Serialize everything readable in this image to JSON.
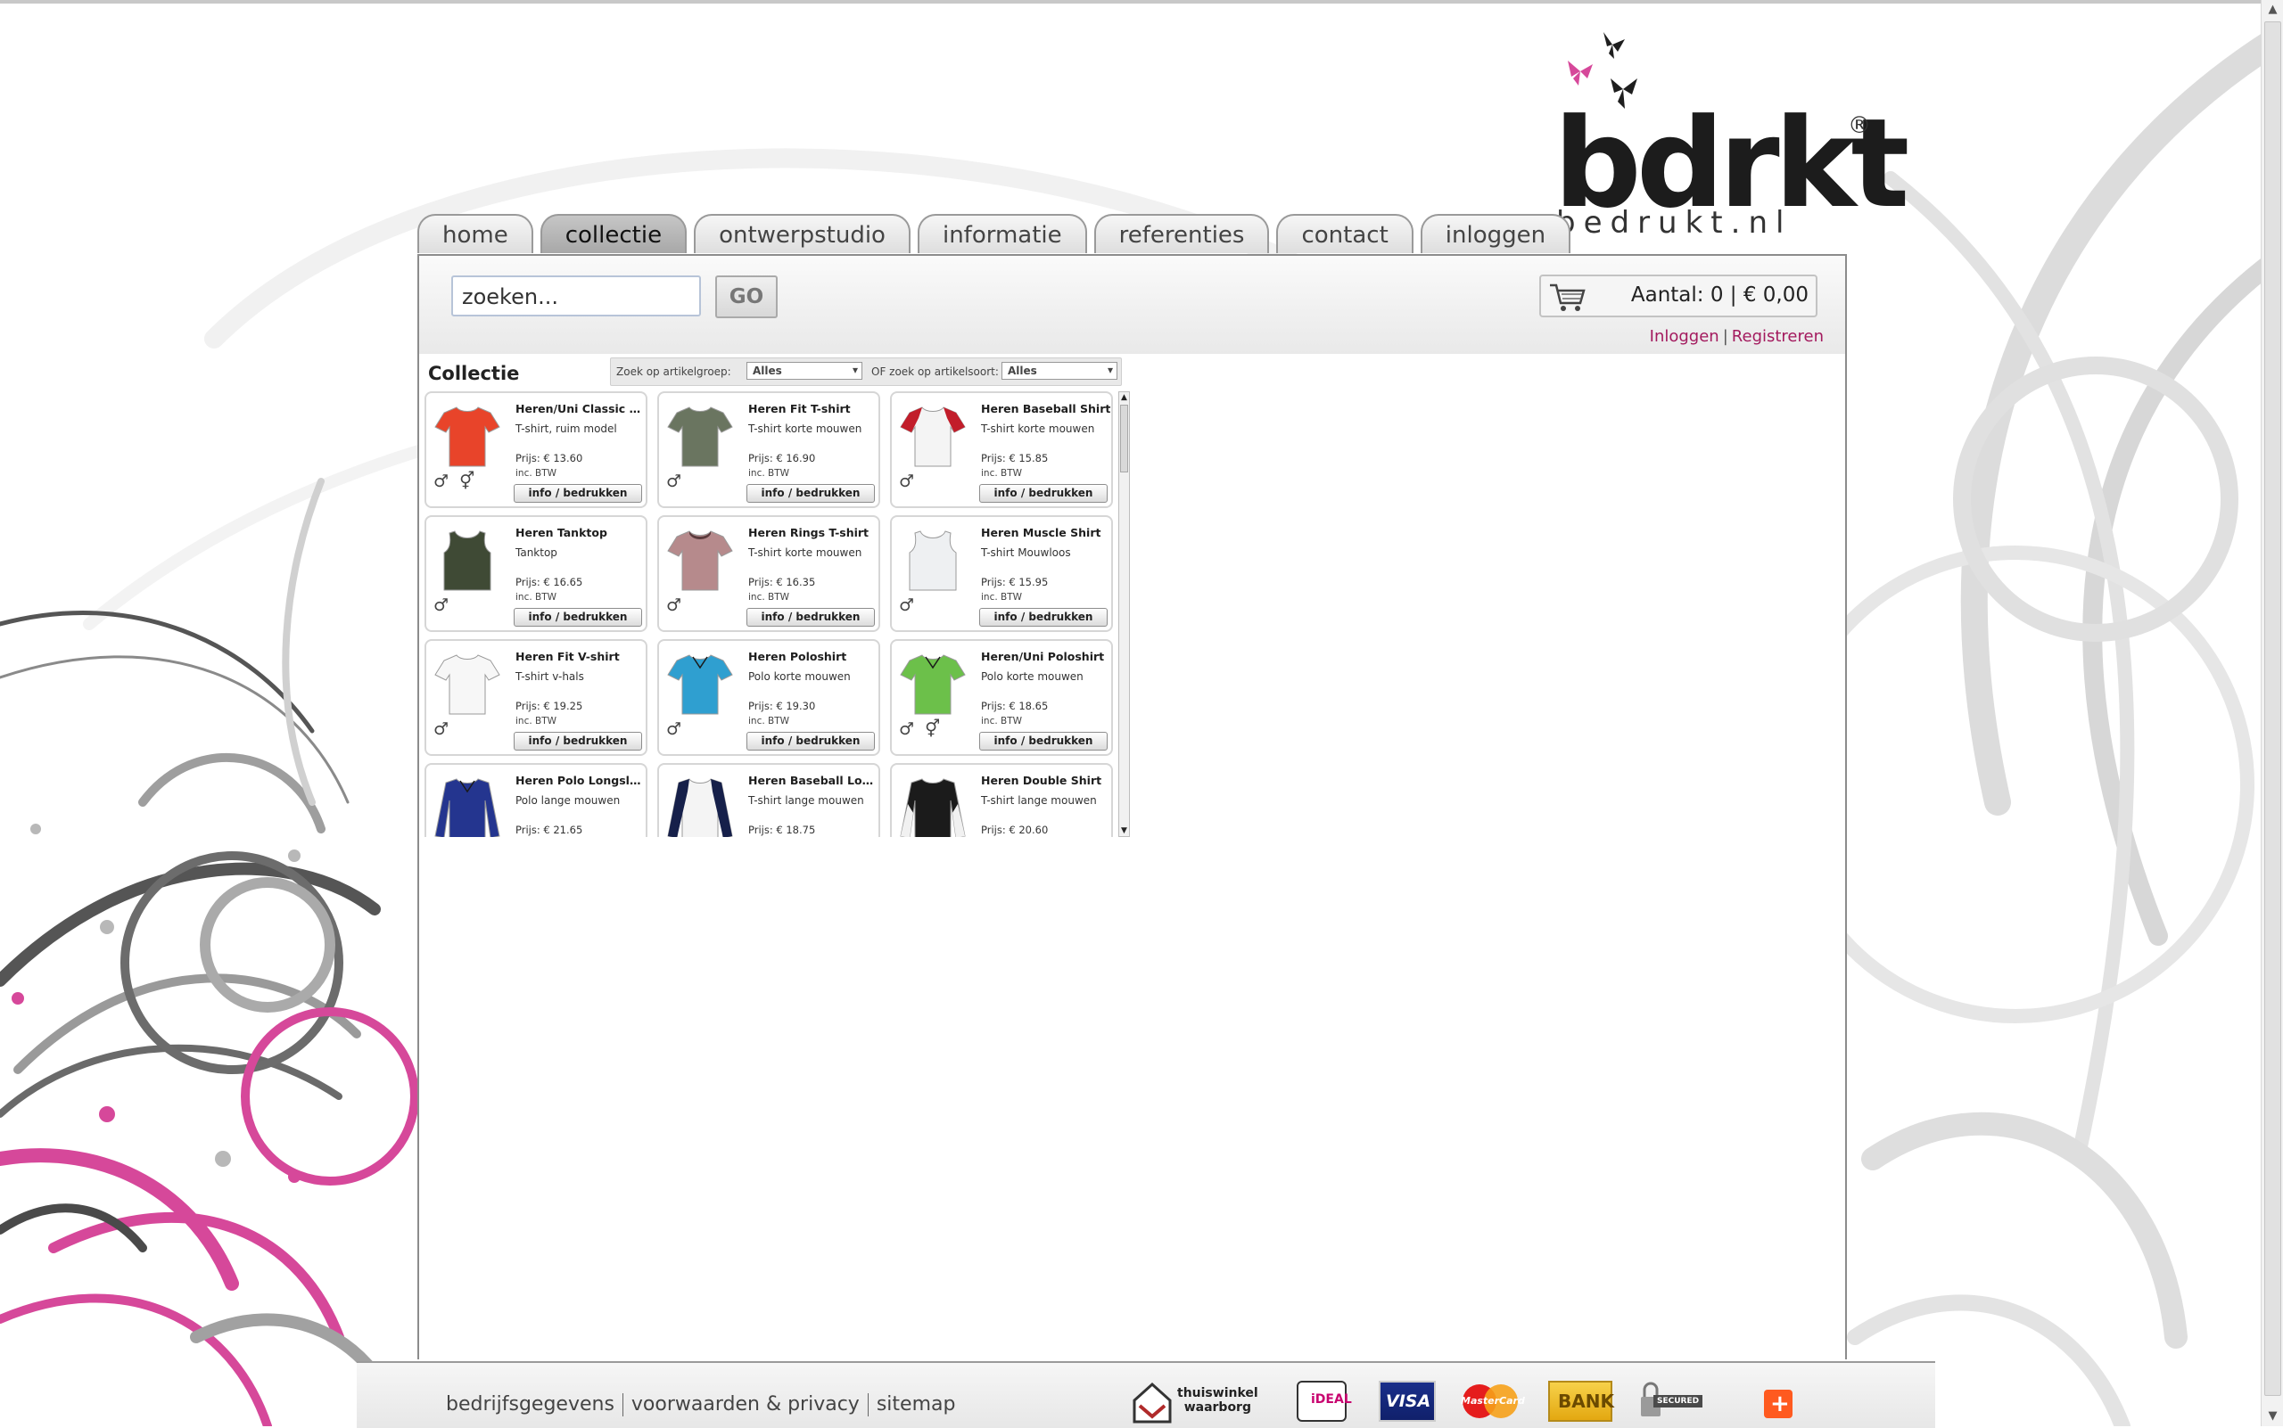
{
  "logo": {
    "brand": "bdrkt",
    "registered": "®",
    "subtitle": "bedrukt.nl"
  },
  "nav": {
    "home": "home",
    "collectie": "collectie",
    "ontwerpstudio": "ontwerpstudio",
    "informatie": "informatie",
    "referenties": "referenties",
    "contact": "contact",
    "inloggen": "inloggen",
    "active": "collectie"
  },
  "search": {
    "value": "zoeken...",
    "go_label": "GO"
  },
  "cart": {
    "summary": "Aantal: 0 | € 0,00"
  },
  "account": {
    "login": "Inloggen",
    "separator": "|",
    "register": "Registreren"
  },
  "collection": {
    "title": "Collectie",
    "filter_group_label": "Zoek op artikelgroep:",
    "filter_group_value": "Alles",
    "filter_type_label": "OF zoek op artikelsoort:",
    "filter_type_value": "Alles",
    "btw_label": "inc. BTW",
    "button_label": "info / bedrukken",
    "products": [
      {
        "name": "Heren/Uni Classic T-sh...",
        "desc": "T-shirt, ruim model",
        "price": "Prijs: € 13.60",
        "gender": "♂ ⚥",
        "color": "#e8442a",
        "shape": "tee"
      },
      {
        "name": "Heren Fit T-shirt",
        "desc": "T-shirt korte mouwen",
        "price": "Prijs: € 16.90",
        "gender": "♂",
        "color": "#6a7560",
        "shape": "tee"
      },
      {
        "name": "Heren Baseball Shirt",
        "desc": "T-shirt korte mouwen",
        "price": "Prijs: € 15.85",
        "gender": "♂",
        "color": "#f4f4f4",
        "accent": "#c21d2a",
        "shape": "raglan"
      },
      {
        "name": "Heren Tanktop",
        "desc": "Tanktop",
        "price": "Prijs: € 16.65",
        "gender": "♂",
        "color": "#3f4a35",
        "shape": "tank"
      },
      {
        "name": "Heren Rings T-shirt",
        "desc": "T-shirt korte mouwen",
        "price": "Prijs: € 16.35",
        "gender": "♂",
        "color": "#b68a8c",
        "accent": "#5a3a3c",
        "shape": "tee"
      },
      {
        "name": "Heren Muscle Shirt",
        "desc": "T-shirt Mouwloos",
        "price": "Prijs: € 15.95",
        "gender": "♂",
        "color": "#eef0f2",
        "shape": "tank"
      },
      {
        "name": "Heren Fit V-shirt",
        "desc": "T-shirt v-hals",
        "price": "Prijs: € 19.25",
        "gender": "♂",
        "color": "#f7f7f7",
        "shape": "tee"
      },
      {
        "name": "Heren Poloshirt",
        "desc": "Polo korte mouwen",
        "price": "Prijs: € 19.30",
        "gender": "♂",
        "color": "#2f9fd0",
        "shape": "polo"
      },
      {
        "name": "Heren/Uni Poloshirt",
        "desc": "Polo korte mouwen",
        "price": "Prijs: € 18.65",
        "gender": "♂ ⚥",
        "color": "#6cc04a",
        "shape": "polo"
      },
      {
        "name": "Heren Polo Longsleeve",
        "desc": "Polo lange mouwen",
        "price": "Prijs: € 21.65",
        "gender": "",
        "color": "#24358f",
        "shape": "long"
      },
      {
        "name": "Heren Baseball Longsl...",
        "desc": "T-shirt lange mouwen",
        "price": "Prijs: € 18.75",
        "gender": "",
        "color": "#f4f4f4",
        "accent": "#16204a",
        "shape": "longraglan"
      },
      {
        "name": "Heren Double Shirt",
        "desc": "T-shirt lange mouwen",
        "price": "Prijs: € 20.60",
        "gender": "",
        "color": "#1b1b1b",
        "accent": "#f1f1f1",
        "shape": "longdouble"
      }
    ]
  },
  "footer": {
    "links": [
      "bedrijfsgegevens",
      "voorwaarden & privacy",
      "sitemap"
    ],
    "badges": {
      "thuiswinkel": "thuiswinkel\nwaarborg",
      "ideal": "iDEAL",
      "visa": "VISA",
      "mastercard": "MasterCard",
      "bank": "BANK",
      "secured": "SECURED",
      "plus": "+"
    }
  },
  "icons": [
    "cart-icon",
    "butterfly-icon",
    "male-icon",
    "unisex-icon",
    "scroll-up-icon",
    "scroll-down-icon",
    "dropdown-arrow-icon"
  ],
  "colors": {
    "accent_link": "#a31a5e",
    "tab_border": "#9a9a9a",
    "pink_swirl": "#d6489a"
  }
}
